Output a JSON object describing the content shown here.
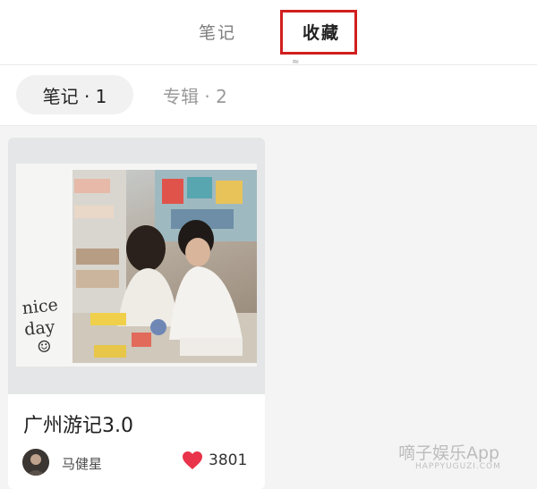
{
  "tabs": {
    "notes_label": "笔记",
    "favorites_label": "收藏",
    "favorites_sub_mark": "≈"
  },
  "filters": {
    "active_label": "笔记 · 1",
    "inactive_label": "专辑 · 2"
  },
  "card": {
    "title": "广州游记3.0",
    "author": "马健星",
    "likes": "3801",
    "handwriting_line1": "nice",
    "handwriting_line2": "day",
    "handwriting_smile": "☺"
  },
  "watermark": {
    "main": "嘀子娱乐App",
    "sub": "HAPPYUGUZI.COM"
  },
  "colors": {
    "highlight_border": "#d11f1f",
    "heart": "#e8334a",
    "active_pill_bg": "#f1f1f1"
  },
  "icons": [
    "heart-icon",
    "avatar"
  ]
}
